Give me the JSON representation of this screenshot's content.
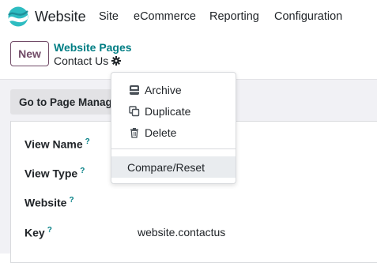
{
  "navbar": {
    "app_name": "Website",
    "menu": [
      "Site",
      "eCommerce",
      "Reporting",
      "Configuration"
    ]
  },
  "control_panel": {
    "new_label": "New",
    "breadcrumb_parent": "Website Pages",
    "breadcrumb_current": "Contact Us"
  },
  "smart_button": {
    "label": "Go to Page Manag"
  },
  "form": {
    "fields": [
      {
        "label": "View Name",
        "help": "?",
        "value": ""
      },
      {
        "label": "View Type",
        "help": "?",
        "value": ""
      },
      {
        "label": "Website",
        "help": "?",
        "value": ""
      },
      {
        "label": "Key",
        "help": "?",
        "value": "website.contactus"
      }
    ]
  },
  "actions_menu": {
    "archive": "Archive",
    "duplicate": "Duplicate",
    "delete": "Delete",
    "compare_reset": "Compare/Reset"
  },
  "colors": {
    "brand": "#714b67",
    "link": "#017e84"
  }
}
